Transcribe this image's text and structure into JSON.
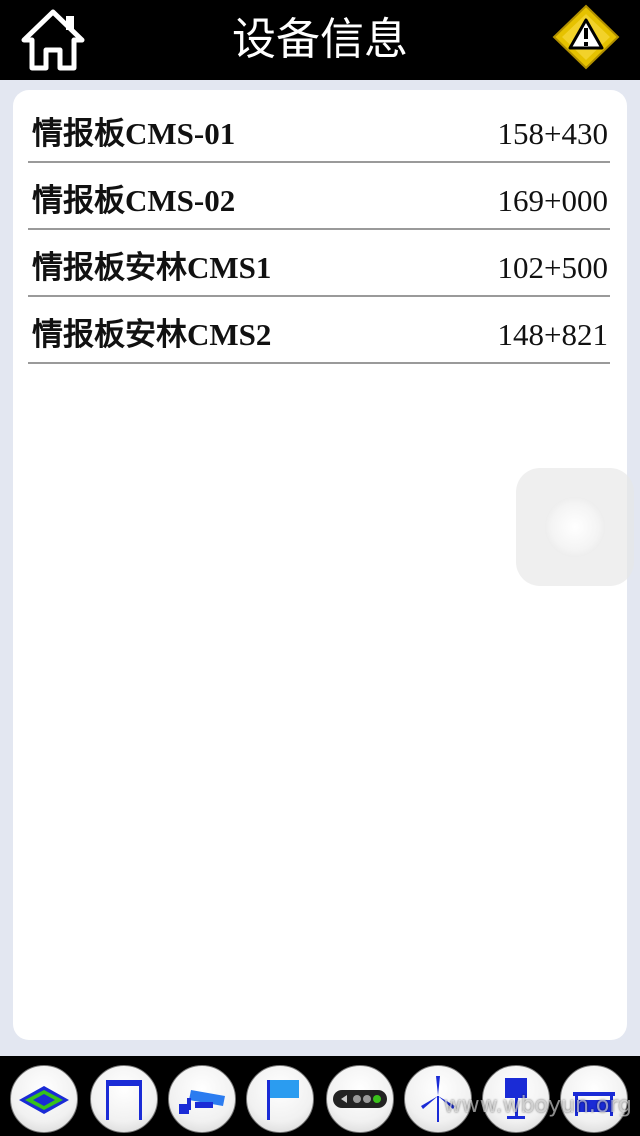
{
  "header": {
    "title": "设备信息",
    "home_icon": "home-icon",
    "warning_icon": "warning-icon"
  },
  "devices": [
    {
      "name": "情报板CMS-01",
      "value": "158+430"
    },
    {
      "name": "情报板CMS-02",
      "value": "169+000"
    },
    {
      "name": "情报板安林CMS1",
      "value": "102+500"
    },
    {
      "name": "情报板安林CMS2",
      "value": "148+821"
    }
  ],
  "toolbar": [
    {
      "icon": "layers-icon"
    },
    {
      "icon": "gantry-icon"
    },
    {
      "icon": "camera-icon"
    },
    {
      "icon": "flag-icon"
    },
    {
      "icon": "traffic-light-icon"
    },
    {
      "icon": "wind-turbine-icon"
    },
    {
      "icon": "sign-board-icon"
    },
    {
      "icon": "barrier-icon"
    }
  ],
  "watermark": "www.wboyun.org",
  "colors": {
    "bar": "#000000",
    "background": "#e3e7f1",
    "accent_blue": "#1a2bd6"
  }
}
